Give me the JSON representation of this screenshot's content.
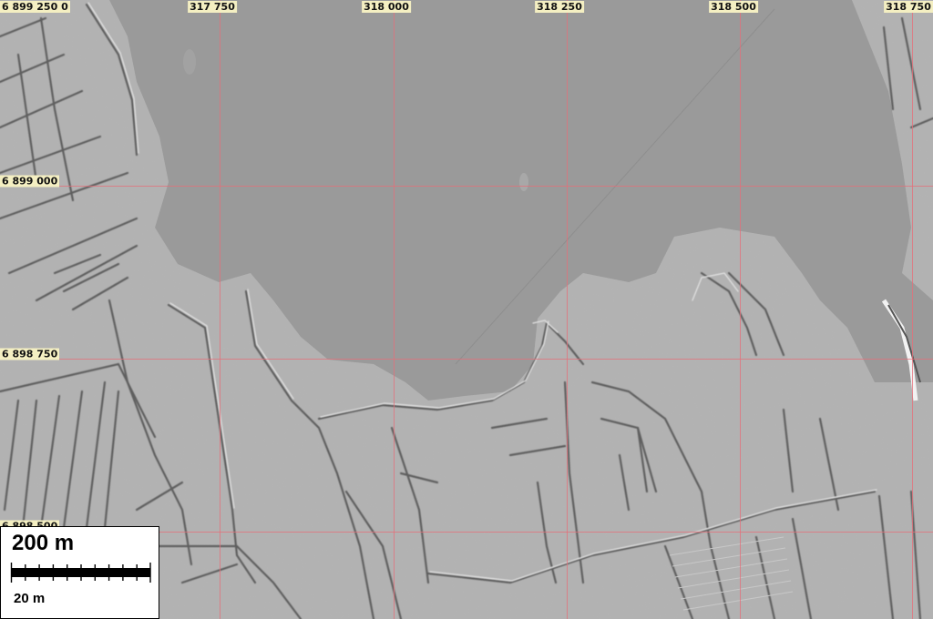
{
  "map": {
    "type": "lidar hillshade",
    "colors": {
      "water": "#9a9a9a",
      "land": "#b4b4b4",
      "grid_line": "#e66e78",
      "label_bg": "#f4efc2"
    },
    "easting_labels": [
      "6 899 250 0",
      "317 750",
      "318 000",
      "318 250",
      "318 500",
      "318 750"
    ],
    "northing_labels": [
      "6 899 000",
      "6 898 750",
      "6 898 500"
    ],
    "scale": {
      "main_label": "200 m",
      "minor_label": "20 m"
    }
  }
}
